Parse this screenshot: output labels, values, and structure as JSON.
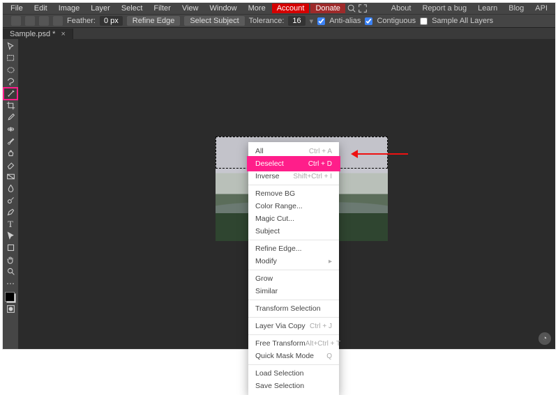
{
  "menubar": {
    "items": [
      "File",
      "Edit",
      "Image",
      "Layer",
      "Select",
      "Filter",
      "View",
      "Window",
      "More"
    ],
    "account": "Account",
    "donate": "Donate",
    "right": [
      "About",
      "Report a bug",
      "Learn",
      "Blog",
      "API"
    ]
  },
  "optbar": {
    "feather_label": "Feather:",
    "feather_value": "0 px",
    "refine": "Refine Edge",
    "select_subject": "Select Subject",
    "tolerance_label": "Tolerance:",
    "tolerance_value": "16",
    "anti_alias": "Anti-alias",
    "contiguous": "Contiguous",
    "sample_all": "Sample All Layers"
  },
  "tab": {
    "name": "Sample.psd *"
  },
  "context_menu": [
    {
      "label": "All",
      "shortcut": "Ctrl + A"
    },
    {
      "label": "Deselect",
      "shortcut": "Ctrl + D",
      "highlight": true
    },
    {
      "label": "Inverse",
      "shortcut": "Shift+Ctrl + I"
    },
    {
      "sep": true
    },
    {
      "label": "Remove BG"
    },
    {
      "label": "Color Range..."
    },
    {
      "label": "Magic Cut..."
    },
    {
      "label": "Subject"
    },
    {
      "sep": true
    },
    {
      "label": "Refine Edge..."
    },
    {
      "label": "Modify",
      "submenu": true
    },
    {
      "sep": true
    },
    {
      "label": "Grow"
    },
    {
      "label": "Similar"
    },
    {
      "sep": true
    },
    {
      "label": "Transform Selection"
    },
    {
      "sep": true
    },
    {
      "label": "Layer Via Copy",
      "shortcut": "Ctrl + J"
    },
    {
      "sep": true
    },
    {
      "label": "Free Transform",
      "shortcut": "Alt+Ctrl + T"
    },
    {
      "label": "Quick Mask Mode",
      "shortcut": "Q"
    },
    {
      "sep": true
    },
    {
      "label": "Load Selection"
    },
    {
      "label": "Save Selection"
    }
  ],
  "tools": [
    "move",
    "rect-select",
    "ellipse-select",
    "lasso",
    "magic-wand",
    "crop",
    "eyedropper",
    "healing",
    "brush",
    "clone",
    "eraser",
    "gradient",
    "blur",
    "dodge",
    "pen",
    "type",
    "path-select",
    "rectangle",
    "hand",
    "zoom"
  ]
}
